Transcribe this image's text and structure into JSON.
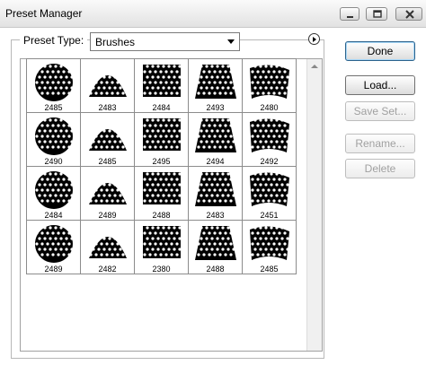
{
  "window": {
    "title": "Preset Manager",
    "controls": [
      "minimize-icon",
      "maximize-icon",
      "close-icon"
    ]
  },
  "preset_type": {
    "label": "Preset Type:",
    "value": "Brushes"
  },
  "brushes": [
    {
      "size": "2485",
      "icon": "sphere-dot-brush-icon"
    },
    {
      "size": "2483",
      "icon": "shell-dot-brush-icon"
    },
    {
      "size": "2484",
      "icon": "square-dot-grid-brush-icon"
    },
    {
      "size": "2493",
      "icon": "trapezoid-dot-brush-icon"
    },
    {
      "size": "2480",
      "icon": "wavy-dot-sheet-brush-icon"
    },
    {
      "size": "2490",
      "icon": "perspective-dot-sheet-brush-icon"
    },
    {
      "size": "2485",
      "icon": "tilted-dot-sheet-brush-icon"
    },
    {
      "size": "2495",
      "icon": "dome-dot-brush-icon"
    },
    {
      "size": "2494",
      "icon": "dot-ribbon-brush-icon"
    },
    {
      "size": "2492",
      "icon": "fan-dot-brush-icon"
    },
    {
      "size": "2484",
      "icon": "curved-dot-sheet-brush-icon"
    },
    {
      "size": "2489",
      "icon": "triangle-dot-brush-icon"
    },
    {
      "size": "2488",
      "icon": "bulged-dot-grid-brush-icon"
    },
    {
      "size": "2483",
      "icon": "spiral-dot-brush-icon"
    },
    {
      "size": "2451",
      "icon": "globe-dot-brush-icon"
    },
    {
      "size": "2489",
      "icon": "fold-dot-sheet-brush-icon"
    },
    {
      "size": "2482",
      "icon": "arch-dot-brush-icon"
    },
    {
      "size": "2380",
      "icon": "flag-dot-grid-brush-icon"
    },
    {
      "size": "2488",
      "icon": "funnel-dot-brush-icon"
    },
    {
      "size": "2485",
      "icon": "bubble-cluster-brush-icon"
    }
  ],
  "buttons": {
    "done": "Done",
    "load": "Load...",
    "save_set": "Save Set...",
    "rename": "Rename...",
    "delete": "Delete"
  }
}
